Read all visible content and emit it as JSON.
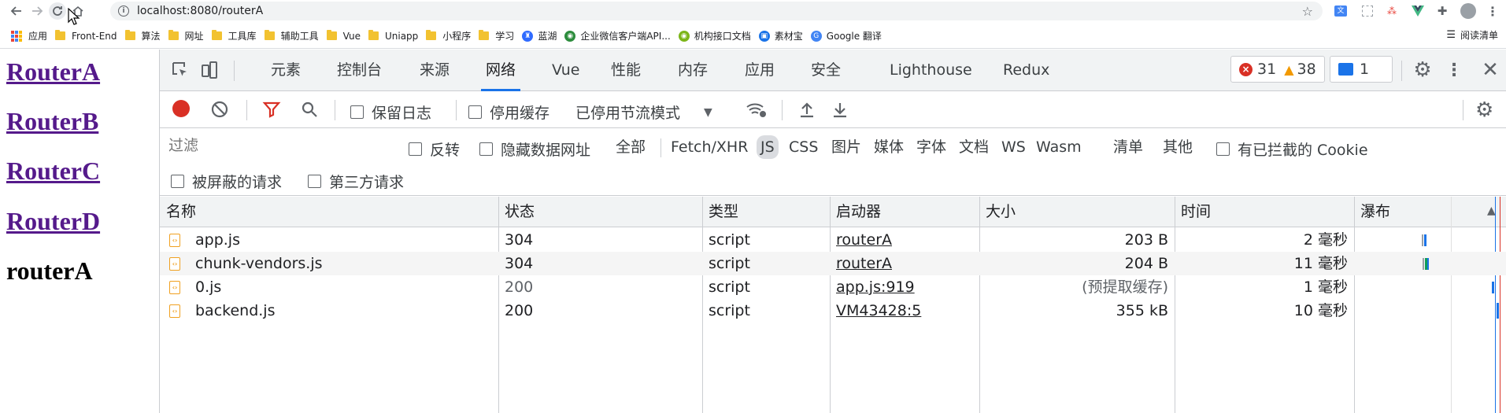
{
  "browser": {
    "url": "localhost:8080/routerA",
    "bookmarks": [
      {
        "label": "应用",
        "icon": "apps-grid-icon"
      },
      {
        "label": "Front-End",
        "icon": "folder-icon"
      },
      {
        "label": "算法",
        "icon": "folder-icon"
      },
      {
        "label": "网址",
        "icon": "folder-icon"
      },
      {
        "label": "工具库",
        "icon": "folder-icon"
      },
      {
        "label": "辅助工具",
        "icon": "folder-icon"
      },
      {
        "label": "Vue",
        "icon": "folder-icon"
      },
      {
        "label": "Uniapp",
        "icon": "folder-icon"
      },
      {
        "label": "小程序",
        "icon": "folder-icon"
      },
      {
        "label": "学习",
        "icon": "folder-icon"
      },
      {
        "label": "蓝湖",
        "icon": "lanhu-icon"
      },
      {
        "label": "企业微信客户端API...",
        "icon": "wecom-icon"
      },
      {
        "label": "机构接口文档",
        "icon": "api-doc-icon"
      },
      {
        "label": "素材宝",
        "icon": "sucaibao-icon"
      },
      {
        "label": "Google 翻译",
        "icon": "translate-icon"
      }
    ],
    "reading_list": "阅读清单"
  },
  "page": {
    "links": [
      "RouterA",
      "RouterB",
      "RouterC",
      "RouterD"
    ],
    "current": "routerA"
  },
  "devtools": {
    "tabs": [
      "元素",
      "控制台",
      "来源",
      "网络",
      "Vue",
      "性能",
      "内存",
      "应用",
      "安全",
      "Lighthouse",
      "Redux"
    ],
    "active_tab": "网络",
    "errors": "31",
    "warnings": "38",
    "messages": "1",
    "toolbar": {
      "preserve_log": "保留日志",
      "disable_cache": "停用缓存",
      "throttle": "已停用节流模式"
    },
    "filter": {
      "placeholder": "过滤",
      "invert": "反转",
      "hide_data_urls": "隐藏数据网址",
      "types": [
        "全部",
        "Fetch/XHR",
        "JS",
        "CSS",
        "图片",
        "媒体",
        "字体",
        "文档",
        "WS",
        "Wasm",
        "清单",
        "其他"
      ],
      "active_type": "JS",
      "blocked_cookies": "有已拦截的 Cookie",
      "blocked_requests": "被屏蔽的请求",
      "third_party": "第三方请求"
    },
    "table": {
      "columns": [
        "名称",
        "状态",
        "类型",
        "启动器",
        "大小",
        "时间",
        "瀑布"
      ],
      "rows": [
        {
          "name": "app.js",
          "status": "304",
          "type": "script",
          "initiator": "routerA",
          "size": "203 B",
          "time": "2 毫秒"
        },
        {
          "name": "chunk-vendors.js",
          "status": "304",
          "type": "script",
          "initiator": "routerA",
          "size": "204 B",
          "time": "11 毫秒"
        },
        {
          "name": "0.js",
          "status": "200",
          "type": "script",
          "initiator": "app.js:919",
          "size": "(预提取缓存)",
          "time": "1 毫秒"
        },
        {
          "name": "backend.js",
          "status": "200",
          "type": "script",
          "initiator": "VM43428:5",
          "size": "355 kB",
          "time": "10 毫秒"
        }
      ]
    },
    "colors": {
      "accent": "#1a73e8",
      "record": "#d93025",
      "error": "#d93025",
      "warning": "#f29900"
    }
  }
}
